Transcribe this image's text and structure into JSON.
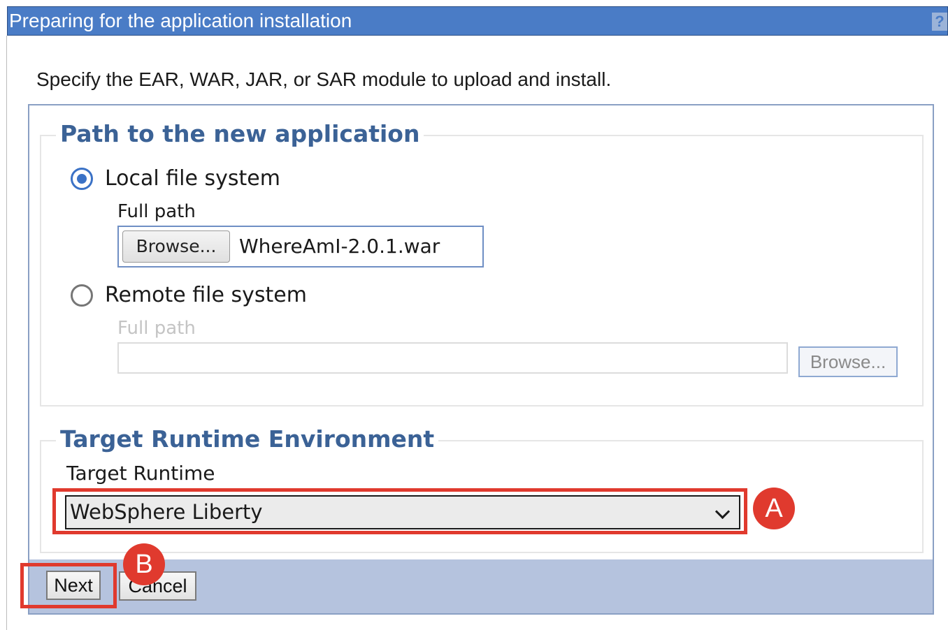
{
  "window": {
    "title": "Preparing for the application installation",
    "help_label": "?"
  },
  "instruction": "Specify the EAR, WAR, JAR, or SAR module to upload and install.",
  "path_section": {
    "legend": "Path to the new application",
    "local": {
      "label": "Local file system",
      "checked": true,
      "full_path_label": "Full path",
      "browse_label": "Browse...",
      "file_name": "WhereAmI-2.0.1.war"
    },
    "remote": {
      "label": "Remote file system",
      "checked": false,
      "full_path_label": "Full path",
      "value": "",
      "browse_label": "Browse..."
    }
  },
  "runtime_section": {
    "legend": "Target Runtime Environment",
    "target_runtime_label": "Target Runtime",
    "selected_value": "WebSphere Liberty"
  },
  "buttons": {
    "next_label": "Next",
    "cancel_label": "Cancel"
  },
  "annotations": {
    "marker_a": "A",
    "marker_b": "B",
    "color": "#e03a2e"
  },
  "colors": {
    "titlebar": "#4a7cc6",
    "legend_text": "#3b6296",
    "footer": "#b5c3de"
  }
}
